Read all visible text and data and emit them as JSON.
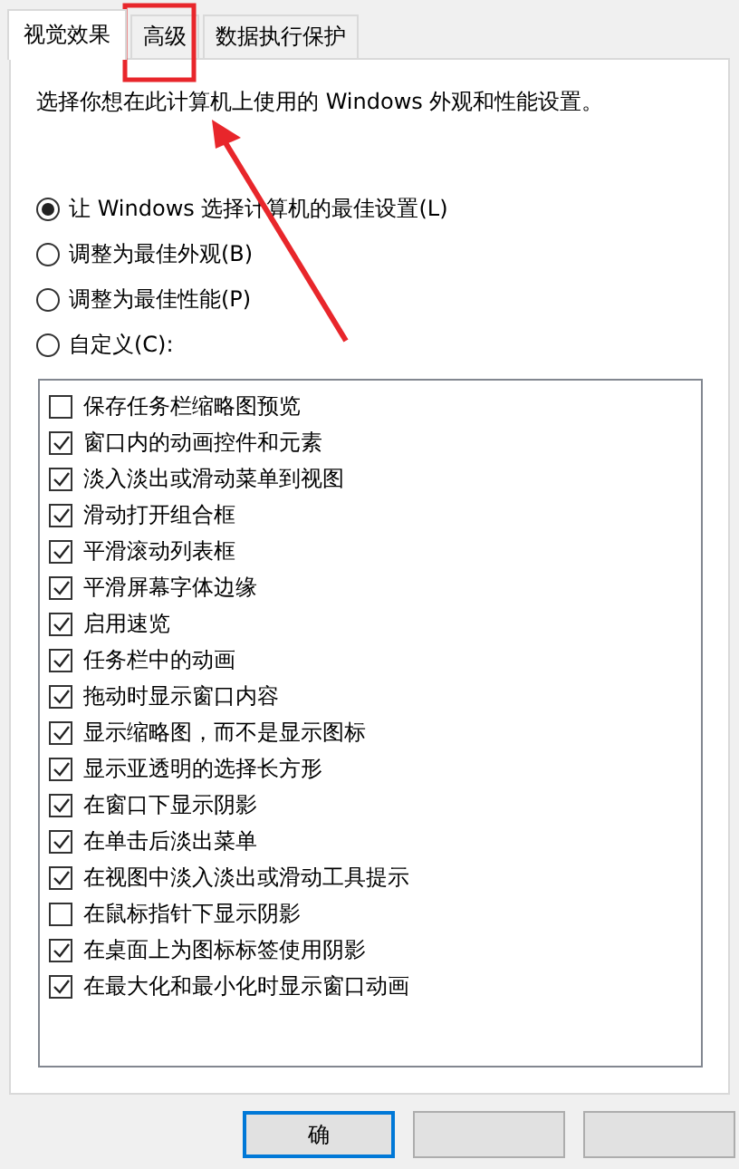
{
  "tabs": [
    {
      "label": "视觉效果",
      "selected": true
    },
    {
      "label": "高级",
      "selected": false
    },
    {
      "label": "数据执行保护",
      "selected": false
    }
  ],
  "description": "选择你想在此计算机上使用的 Windows 外观和性能设置。",
  "options": [
    {
      "label": "让 Windows 选择计算机的最佳设置(L)",
      "selected": true
    },
    {
      "label": "调整为最佳外观(B)",
      "selected": false
    },
    {
      "label": "调整为最佳性能(P)",
      "selected": false
    },
    {
      "label": "自定义(C):",
      "selected": false
    }
  ],
  "effects": [
    {
      "label": "保存任务栏缩略图预览",
      "checked": false
    },
    {
      "label": "窗口内的动画控件和元素",
      "checked": true
    },
    {
      "label": "淡入淡出或滑动菜单到视图",
      "checked": true
    },
    {
      "label": "滑动打开组合框",
      "checked": true
    },
    {
      "label": "平滑滚动列表框",
      "checked": true
    },
    {
      "label": "平滑屏幕字体边缘",
      "checked": true
    },
    {
      "label": "启用速览",
      "checked": true
    },
    {
      "label": "任务栏中的动画",
      "checked": true
    },
    {
      "label": "拖动时显示窗口内容",
      "checked": true
    },
    {
      "label": "显示缩略图，而不是显示图标",
      "checked": true
    },
    {
      "label": "显示亚透明的选择长方形",
      "checked": true
    },
    {
      "label": "在窗口下显示阴影",
      "checked": true
    },
    {
      "label": "在单击后淡出菜单",
      "checked": true
    },
    {
      "label": "在视图中淡入淡出或滑动工具提示",
      "checked": true
    },
    {
      "label": "在鼠标指针下显示阴影",
      "checked": false
    },
    {
      "label": "在桌面上为图标标签使用阴影",
      "checked": true
    },
    {
      "label": "在最大化和最小化时显示窗口动画",
      "checked": true
    }
  ],
  "buttons": [
    {
      "label": "确",
      "default": true
    },
    {
      "default": false
    },
    {
      "default": false
    }
  ]
}
